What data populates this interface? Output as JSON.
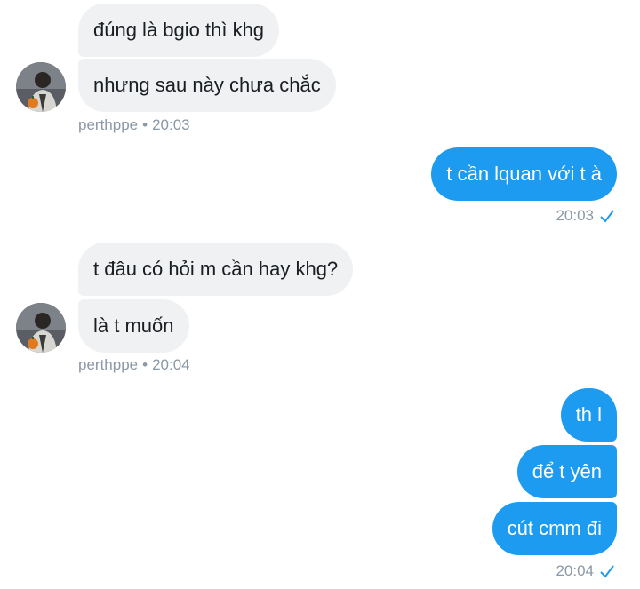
{
  "contact": {
    "username": "perthppe",
    "avatar_icon": "person-with-pumpkin-avatar"
  },
  "groups": [
    {
      "sender": "them",
      "messages": [
        "đúng là bgio thì khg",
        "nhưng sau này chưa chắc"
      ],
      "time": "20:03"
    },
    {
      "sender": "me",
      "messages": [
        "t cần lquan với t à"
      ],
      "time": "20:03",
      "status_icon": "check-icon"
    },
    {
      "sender": "them",
      "messages": [
        "t đâu có hỏi m cần hay khg?",
        "là t muốn"
      ],
      "time": "20:04"
    },
    {
      "sender": "me",
      "messages": [
        "th l",
        "để t yên",
        "cút cmm đi"
      ],
      "time": "20:04",
      "status_icon": "check-icon"
    }
  ],
  "colors": {
    "sent_bubble": "#1d9bf0",
    "received_bubble": "#eff1f3",
    "meta_text": "#8b98a5",
    "check": "#1d9bf0"
  }
}
